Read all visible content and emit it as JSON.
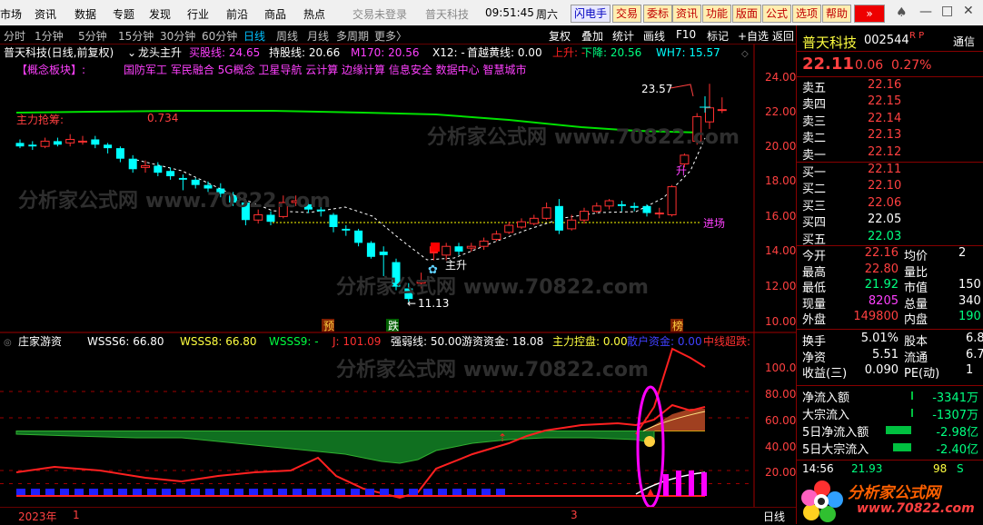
{
  "menu": {
    "items": [
      "市场",
      "资讯",
      "数据",
      "专题",
      "发现",
      "行业",
      "前沿",
      "商品",
      "热点"
    ],
    "login": "交易未登录",
    "brand": "普天科技",
    "time": "09:51:45",
    "weekday": "周六",
    "buttons": [
      "闪电手",
      "交易",
      "委标",
      "资讯",
      "功能",
      "版面",
      "公式",
      "选项",
      "帮助"
    ]
  },
  "periods": {
    "items": [
      "分时",
      "1分钟",
      "5分钟",
      "15分钟",
      "30分钟",
      "60分钟",
      "日线",
      "周线",
      "月线",
      "多周期",
      "更多〉"
    ],
    "selected": "日线",
    "tools": [
      "复权",
      "叠加",
      "统计",
      "画线",
      "F10",
      "标记",
      "+自选",
      "返回"
    ]
  },
  "main_chart": {
    "header": {
      "name": "普天科技(日线,前复权)",
      "formula": "龙头主升",
      "buy_line": "买股线: 24.65",
      "hold_line": "持股线: 20.66",
      "m170": "M170: 20.56",
      "x12": "X12: -",
      "first_yellow": "首越黄线: 0.00",
      "up_label": "上升: -",
      "down_label": "下降: 20.56",
      "wh7": "WH7: 15.57"
    },
    "concept_label": "【概念板块】:",
    "concepts": "国防军工 军民融合 5G概念 卫星导航 云计算 边缘计算 信息安全 数据中心 智慧城市",
    "capital_label": "主力抢筹:",
    "capital_value": "0.734",
    "high_annot": "23.57",
    "low_annot": "11.13",
    "main_rise": "主升",
    "entry": "进场",
    "rise_mark": "升",
    "markers": [
      "预",
      "跌",
      "榜"
    ],
    "yaxis": [
      "24.00",
      "22.00",
      "20.00",
      "18.00",
      "16.00",
      "14.00",
      "12.00",
      "10.00"
    ]
  },
  "sub_chart": {
    "name": "庄家游资",
    "wsss6": "WSSS6: 66.80",
    "wsss8": "WSSS8: 66.80",
    "wsss9": "WSSS9: -",
    "j": "J: 101.09",
    "strength": "强弱线: 50.00",
    "hot_money": "游资资金: 18.08",
    "control": "主力控盘: 0.00",
    "retail": "散户资金: 0.00",
    "midline": "中线超跌:",
    "yaxis": [
      "100.0",
      "80.00",
      "60.00",
      "40.00",
      "20.00"
    ]
  },
  "bottom": {
    "year": "2023年",
    "m1": "1",
    "m3": "3",
    "period": "日线"
  },
  "quote": {
    "name": "普天科技",
    "code": "002544",
    "flags": "R P",
    "tab": "通信",
    "price": "22.11",
    "change": "0.06",
    "pct": "0.27%",
    "asks": [
      {
        "label": "卖五",
        "price": "22.16"
      },
      {
        "label": "卖四",
        "price": "22.15"
      },
      {
        "label": "卖三",
        "price": "22.14"
      },
      {
        "label": "卖二",
        "price": "22.13"
      },
      {
        "label": "卖一",
        "price": "22.12"
      }
    ],
    "bids": [
      {
        "label": "买一",
        "price": "22.11"
      },
      {
        "label": "买二",
        "price": "22.10"
      },
      {
        "label": "买三",
        "price": "22.06"
      },
      {
        "label": "买四",
        "price": "22.05"
      },
      {
        "label": "买五",
        "price": "22.03"
      }
    ],
    "stats": [
      {
        "l": "今开",
        "v": "22.16",
        "l2": "均价",
        "v2": "2"
      },
      {
        "l": "最高",
        "v": "22.80",
        "l2": "量比",
        "v2": ""
      },
      {
        "l": "最低",
        "v": "21.92",
        "l2": "市值",
        "v2": "150"
      },
      {
        "l": "现量",
        "v": "8205",
        "l2": "总量",
        "v2": "340"
      },
      {
        "l": "外盘",
        "v": "149800",
        "l2": "内盘",
        "v2": "190"
      }
    ],
    "stats2": [
      {
        "l": "换手",
        "v": "5.01%",
        "l2": "股本",
        "v2": "6.8"
      },
      {
        "l": "净资",
        "v": "5.51",
        "l2": "流通",
        "v2": "6.7"
      },
      {
        "l": "收益(三)",
        "v": "0.090",
        "l2": "PE(动)",
        "v2": "1"
      }
    ],
    "flows": [
      {
        "l": "净流入额",
        "v": "-3341万"
      },
      {
        "l": "大宗流入",
        "v": "-1307万"
      },
      {
        "l": "5日净流入额",
        "v": "-2.98亿"
      },
      {
        "l": "5日大宗流入",
        "v": "-2.40亿"
      }
    ],
    "tick": {
      "time": "14:56",
      "price": "21.93",
      "vol": "98",
      "side": "S"
    }
  },
  "watermark": {
    "cn": "分析家公式网",
    "url": "www.70822.com",
    "logo_cn": "分析家公式网",
    "logo_url": "www.70822.com"
  }
}
